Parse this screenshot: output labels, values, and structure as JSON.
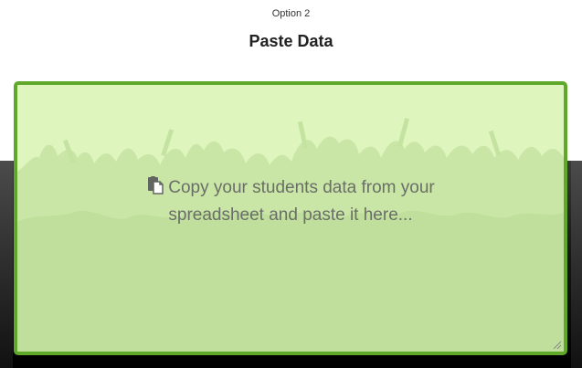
{
  "header": {
    "option_label": "Option 2",
    "title": "Paste Data"
  },
  "paste_area": {
    "placeholder_line1": "Copy your students data from your",
    "placeholder_line2": "spreadsheet and paste it here...",
    "icon": "paste-icon",
    "border_color": "#5fa82a",
    "background_color": "#dff5be"
  }
}
